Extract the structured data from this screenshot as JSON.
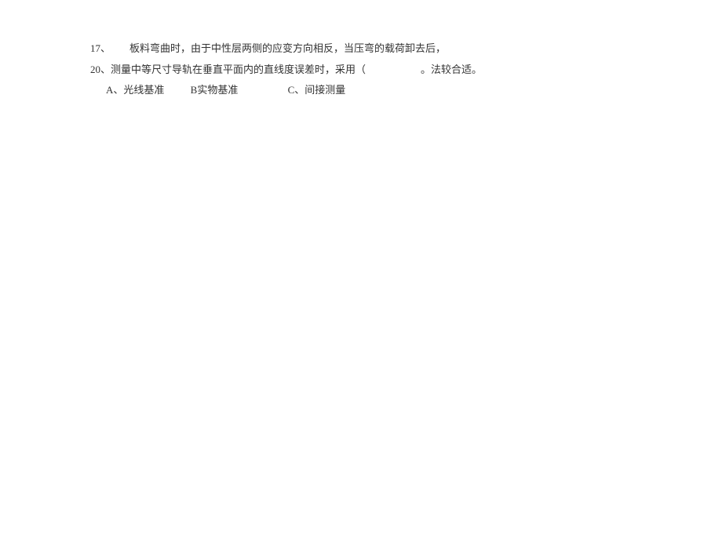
{
  "q17": {
    "number": "17、",
    "text": "板料弯曲时，由于中性层两侧的应变方向相反，当压弯的载荷卸去后，"
  },
  "q20": {
    "number": "20、",
    "text_before_blank": "测量中等尺寸导轨在垂直平面内的直线度误差时，采用（",
    "text_after_blank": "。法较合适。"
  },
  "options": {
    "a_label": "A、",
    "a_text": "光线基准",
    "b_label": "B",
    "b_text": "实物基准",
    "c_label": "C、",
    "c_text": "间接测量"
  }
}
